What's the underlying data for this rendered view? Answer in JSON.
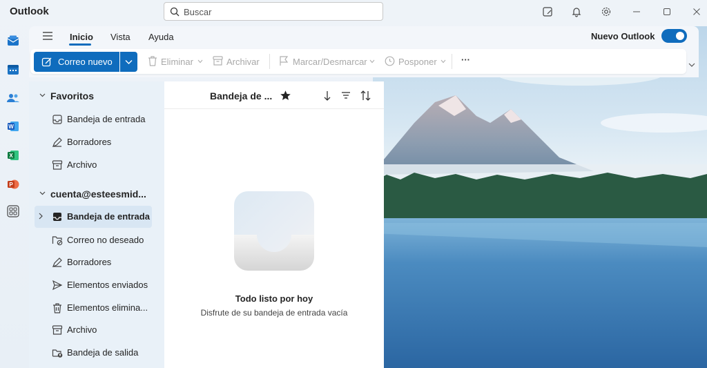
{
  "app": {
    "title": "Outlook"
  },
  "search": {
    "placeholder": "Buscar"
  },
  "titlebar_icons": [
    "sticky-note-icon",
    "bell-icon",
    "gear-icon",
    "minimize-icon",
    "maximize-icon",
    "close-icon"
  ],
  "rail": [
    "mail-icon",
    "calendar-icon",
    "people-icon",
    "word-icon",
    "excel-icon",
    "powerpoint-icon",
    "apps-icon"
  ],
  "tabs": [
    {
      "label": "Inicio",
      "active": true
    },
    {
      "label": "Vista",
      "active": false
    },
    {
      "label": "Ayuda",
      "active": false
    }
  ],
  "new_outlook": {
    "label": "Nuevo Outlook",
    "enabled": true
  },
  "ribbon": {
    "new_mail": "Correo nuevo",
    "delete": "Eliminar",
    "archive": "Archivar",
    "mark": "Marcar/Desmarcar",
    "snooze": "Posponer",
    "more": "···"
  },
  "folders": {
    "favorites_title": "Favoritos",
    "favorites": [
      {
        "label": "Bandeja de entrada",
        "icon": "inbox-icon"
      },
      {
        "label": "Borradores",
        "icon": "pencil-icon"
      },
      {
        "label": "Archivo",
        "icon": "archive-icon"
      }
    ],
    "account_title": "cuenta@esteesmid...",
    "account_items": [
      {
        "label": "Bandeja de entrada",
        "icon": "inbox-icon",
        "selected": true
      },
      {
        "label": "Correo no deseado",
        "icon": "junk-icon"
      },
      {
        "label": "Borradores",
        "icon": "pencil-icon"
      },
      {
        "label": "Elementos enviados",
        "icon": "send-icon"
      },
      {
        "label": "Elementos elimina...",
        "icon": "trash-icon"
      },
      {
        "label": "Archivo",
        "icon": "archive-icon"
      },
      {
        "label": "Bandeja de salida",
        "icon": "outbox-icon"
      }
    ]
  },
  "message_list": {
    "title": "Bandeja de ...",
    "empty_title": "Todo listo por hoy",
    "empty_subtitle": "Disfrute de su bandeja de entrada vacía"
  },
  "colors": {
    "accent": "#0f6cbd",
    "folder_pane": "#e9f1f8",
    "selected": "#d8e6f3"
  }
}
